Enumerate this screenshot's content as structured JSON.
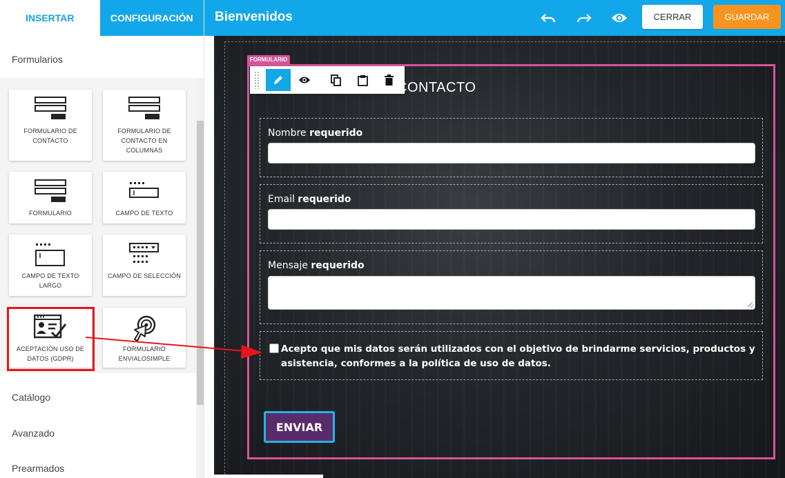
{
  "sidebar": {
    "tabs": [
      {
        "label": "INSERTAR",
        "active": true
      },
      {
        "label": "CONFIGURACIÓN",
        "active": false
      }
    ],
    "section_title": "Formularios",
    "blocks": [
      {
        "label": "FORMULARIO DE CONTACTO",
        "icon": "form-icon"
      },
      {
        "label": "FORMULARIO DE CONTACTO EN COLUMNAS",
        "icon": "form-columns-icon"
      },
      {
        "label": "FORMULARIO",
        "icon": "form-simple-icon"
      },
      {
        "label": "CAMPO DE TEXTO",
        "icon": "text-field-icon"
      },
      {
        "label": "CAMPO DE TEXTO LARGO",
        "icon": "textarea-icon"
      },
      {
        "label": "CAMPO DE SELECCIÓN",
        "icon": "select-field-icon"
      },
      {
        "label": "ACEPTACIÓN USO DE DATOS (GDPR)",
        "icon": "gdpr-consent-icon",
        "highlighted": true
      },
      {
        "label": "FORMULARIO ENVIALOSIMPLE",
        "icon": "target-pointer-icon"
      }
    ],
    "items": [
      "Catálogo",
      "Avanzado",
      "Prearmados"
    ]
  },
  "topbar": {
    "title": "Bienvenidos",
    "icons": [
      "undo-icon",
      "redo-icon",
      "preview-eye-icon"
    ],
    "close_label": "CERRAR",
    "save_label": "GUARDAR"
  },
  "editor": {
    "form_tag": "FORMULARIO",
    "toolbar_icons": [
      "drag-handle-icon",
      "edit-pencil-icon",
      "view-eye-icon",
      "duplicate-icon",
      "paste-icon",
      "delete-trash-icon"
    ],
    "heading": "CONTACTO",
    "fields": [
      {
        "label": "Nombre",
        "required": "requerido"
      },
      {
        "label": "Email",
        "required": "requerido"
      },
      {
        "label": "Mensaje",
        "required": "requerido"
      }
    ],
    "gdpr_text": "Acepto que mis datos serán utilizados con el objetivo de brindarme servicios, productos y asistencia, conformes a la política de uso de datos.",
    "submit_label": "ENVIAR"
  },
  "colors": {
    "accent": "#12a7e8",
    "save": "#f7931e",
    "form_border": "#d6559a",
    "highlight": "#e8141b",
    "submit_bg": "#5a2b6b"
  }
}
